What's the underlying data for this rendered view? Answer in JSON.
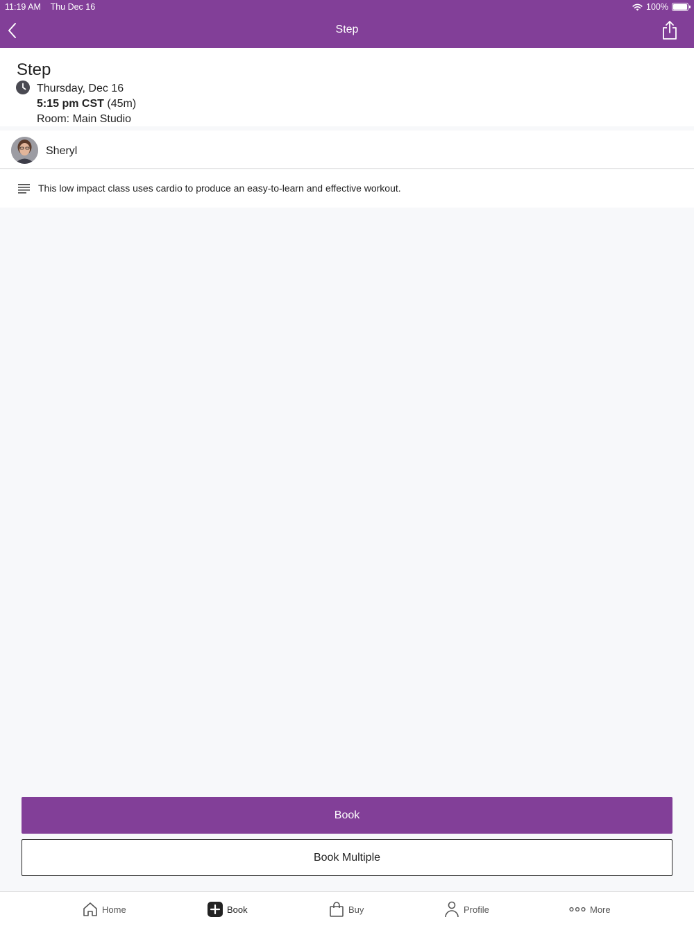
{
  "status_bar": {
    "time": "11:19 AM",
    "date": "Thu Dec 16",
    "battery": "100%"
  },
  "nav": {
    "title": "Step"
  },
  "class": {
    "name": "Step",
    "date": "Thursday, Dec 16",
    "time": "5:15 pm CST",
    "duration": "(45m)",
    "room": "Room: Main Studio"
  },
  "instructor": {
    "name": "Sheryl"
  },
  "description": "This low impact class uses cardio to produce an easy-to-learn and effective workout.",
  "actions": {
    "book": "Book",
    "book_multiple": "Book Multiple"
  },
  "tabs": [
    {
      "label": "Home",
      "icon": "home-icon"
    },
    {
      "label": "Book",
      "icon": "plus-square-icon"
    },
    {
      "label": "Buy",
      "icon": "shopping-bag-icon"
    },
    {
      "label": "Profile",
      "icon": "person-icon"
    },
    {
      "label": "More",
      "icon": "ellipsis-icon"
    }
  ],
  "colors": {
    "brand": "#823f98",
    "background": "#f7f8fa"
  }
}
